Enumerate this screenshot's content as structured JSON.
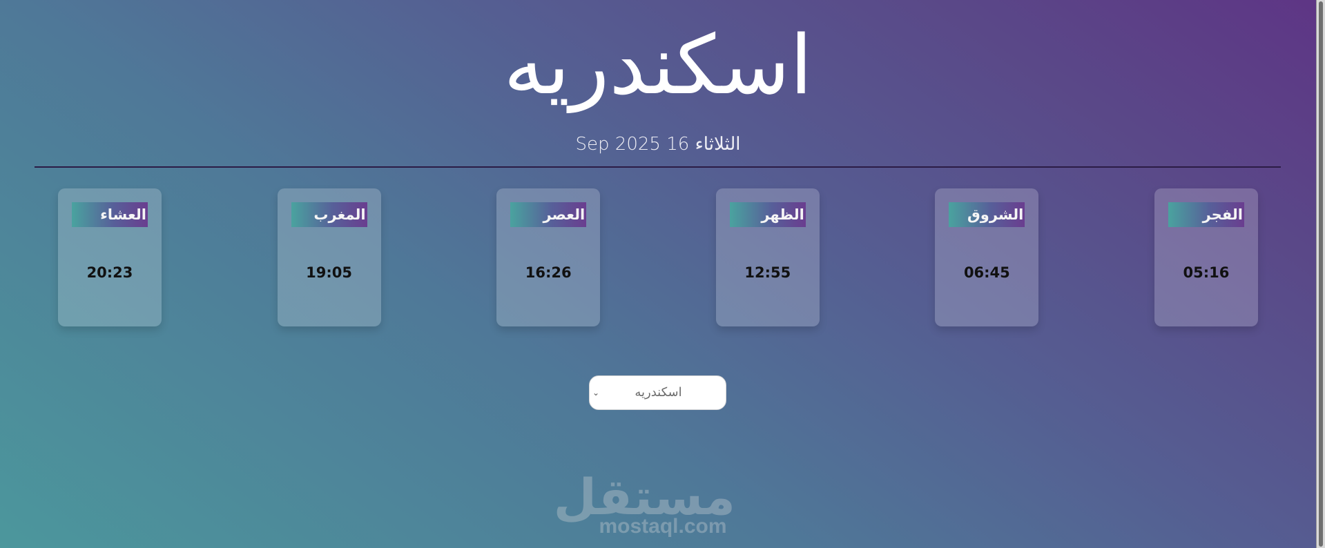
{
  "header": {
    "city": "اسكندريه",
    "date": "الثلاثاء 16 Sep 2025"
  },
  "prayers": [
    {
      "name": "الفجر",
      "time": "05:16"
    },
    {
      "name": "الشروق",
      "time": "06:45"
    },
    {
      "name": "الظهر",
      "time": "12:55"
    },
    {
      "name": "العصر",
      "time": "16:26"
    },
    {
      "name": "المغرب",
      "time": "19:05"
    },
    {
      "name": "العشاء",
      "time": "20:23"
    }
  ],
  "city_select": {
    "selected": "اسكندريه",
    "chevron_icon": "chevron-down-icon"
  },
  "watermark": {
    "arabic": "مستقل",
    "latin": "mostaql.com"
  },
  "colors": {
    "gradient_start": "#4c979c",
    "gradient_end": "#5e3585",
    "label_gradient_start": "#4aa39f",
    "label_gradient_end": "#6a3d8f",
    "divider": "#2b1b45"
  }
}
